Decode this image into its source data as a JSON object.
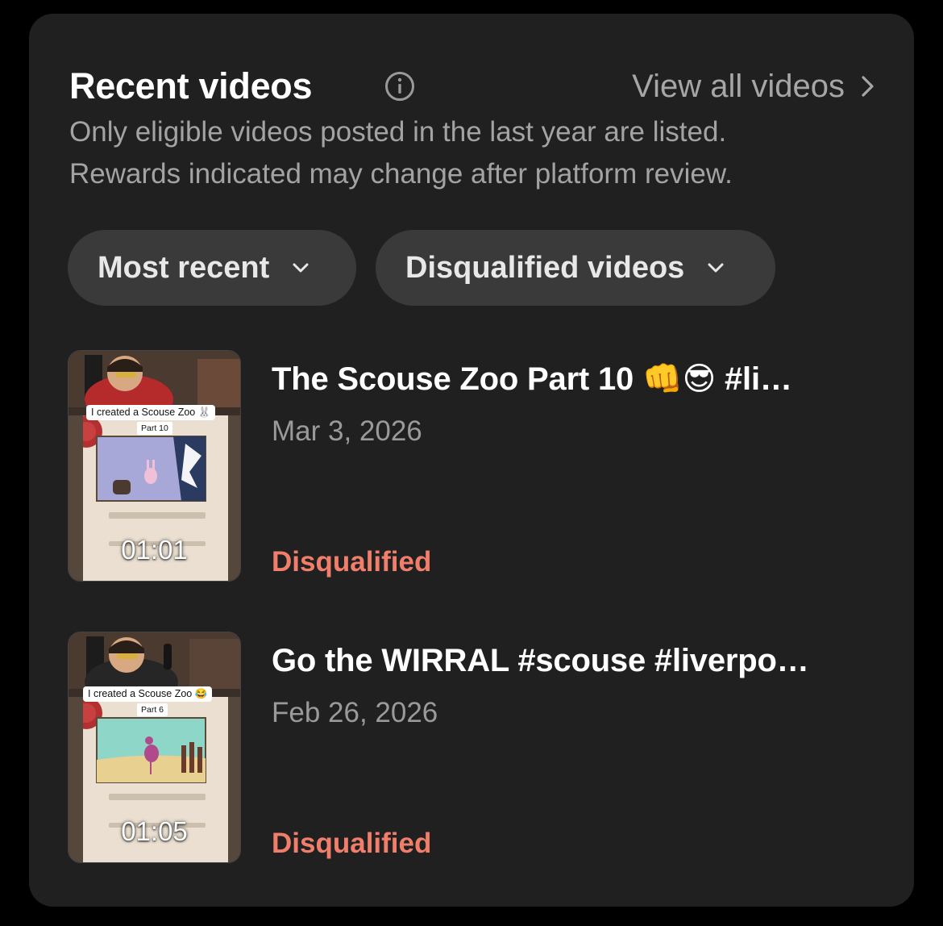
{
  "header": {
    "title": "Recent videos",
    "view_all": "View all videos",
    "subtitle_line1": "Only eligible videos posted in the last year are listed.",
    "subtitle_line2": "Rewards indicated may change after platform review."
  },
  "filters": {
    "sort": "Most recent",
    "status": "Disqualified videos"
  },
  "videos": [
    {
      "title_text": "The Scouse Zoo Part 10 ",
      "title_emoji": "👊😎",
      "title_tail": " #li…",
      "date": "Mar 3, 2026",
      "status": "Disqualified",
      "duration": "01:01",
      "thumb_caption": "I created a Scouse Zoo 🐰",
      "thumb_part": "Part 10",
      "thumb_scene": "snow"
    },
    {
      "title_text": "Go the WIRRAL #scouse #liverpo…",
      "title_emoji": "",
      "title_tail": "",
      "date": "Feb 26, 2026",
      "status": "Disqualified",
      "duration": "01:05",
      "thumb_caption": "I created a Scouse Zoo 😂",
      "thumb_part": "Part 6",
      "thumb_scene": "meadow"
    }
  ],
  "colors": {
    "card_bg": "#202020",
    "pill_bg": "#3a3a3a",
    "disqualified": "#f07e6b",
    "muted_text": "#a3a3a3"
  },
  "icons": {
    "info": "info-circle-icon",
    "view_all": "chevron-right-icon",
    "dropdown": "chevron-down-icon"
  }
}
